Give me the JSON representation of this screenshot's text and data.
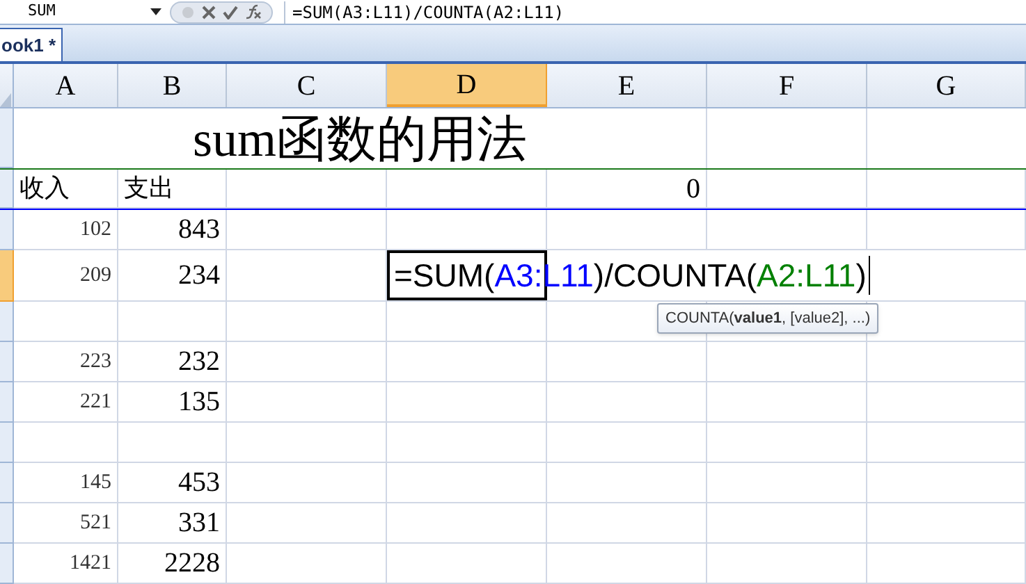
{
  "formula_bar": {
    "name_box": "SUM",
    "formula": "=SUM(A3:L11)/COUNTA(A2:L11)"
  },
  "sheet_tab": {
    "label": "ook1 *"
  },
  "columns": [
    {
      "label": "A",
      "selected": false
    },
    {
      "label": "B",
      "selected": false
    },
    {
      "label": "C",
      "selected": false
    },
    {
      "label": "D",
      "selected": true
    },
    {
      "label": "E",
      "selected": false
    },
    {
      "label": "F",
      "selected": false
    },
    {
      "label": "G",
      "selected": false
    }
  ],
  "rows": [
    {
      "kind": "title",
      "selected": false,
      "text": "sum函数的用法"
    },
    {
      "kind": "header",
      "selected": false,
      "cells": [
        "收入",
        "支出",
        null,
        null,
        "0",
        null,
        null
      ]
    },
    {
      "kind": "data",
      "selected": false,
      "cells": [
        "102",
        "843",
        null,
        null,
        null,
        null,
        null
      ]
    },
    {
      "kind": "editing",
      "selected": true,
      "cells": [
        "209",
        "234",
        null
      ],
      "parts": [
        {
          "text": "=SUM(",
          "color": "#000000"
        },
        {
          "text": "A3:L11",
          "color": "#0000ff"
        },
        {
          "text": ")/COUNTA(",
          "color": "#000000"
        },
        {
          "text": "A2:L11",
          "color": "#008000"
        },
        {
          "text": ")",
          "color": "#000000"
        }
      ]
    },
    {
      "kind": "data",
      "selected": false,
      "cells": [
        null,
        null,
        null,
        null,
        null,
        null,
        null
      ]
    },
    {
      "kind": "data",
      "selected": false,
      "cells": [
        "223",
        "232",
        null,
        null,
        null,
        null,
        null
      ]
    },
    {
      "kind": "data",
      "selected": false,
      "cells": [
        "221",
        "135",
        null,
        null,
        null,
        null,
        null
      ]
    },
    {
      "kind": "data",
      "selected": false,
      "cells": [
        null,
        null,
        null,
        null,
        null,
        null,
        null
      ]
    },
    {
      "kind": "data",
      "selected": false,
      "cells": [
        "145",
        "453",
        null,
        null,
        null,
        null,
        null
      ]
    },
    {
      "kind": "data",
      "selected": false,
      "cells": [
        "521",
        "331",
        null,
        null,
        null,
        null,
        null
      ]
    },
    {
      "kind": "data",
      "selected": false,
      "cells": [
        "1421",
        "2228",
        null,
        null,
        null,
        null,
        null
      ]
    }
  ],
  "tooltip": "COUNTA(**value1**, [value2], ...)"
}
